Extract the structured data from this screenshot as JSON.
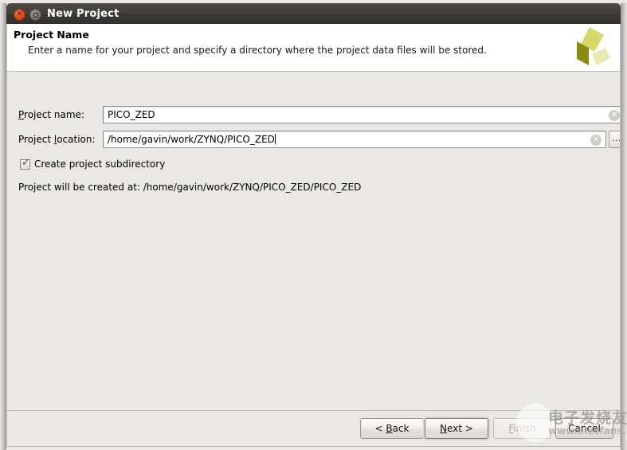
{
  "window": {
    "title": "New Project",
    "close_icon": "close-icon",
    "maximize_icon": "maximize-icon"
  },
  "header": {
    "title": "Project Name",
    "subtitle": "Enter a name for your project and specify a directory where the project data files will be stored.",
    "logo_name": "xilinx-vivado-logo"
  },
  "form": {
    "project_name": {
      "label_pre": "P",
      "label_mnemonic": "",
      "label": "Project name:",
      "value": "PICO_ZED",
      "clear_icon": "clear-icon"
    },
    "project_location": {
      "label": "Project location:",
      "value": "/home/gavin/work/ZYNQ/PICO_ZED",
      "clear_icon": "clear-icon",
      "browse_label": "..."
    },
    "create_subdirectory": {
      "label": "Create project subdirectory",
      "checked": true,
      "check_glyph": "✓"
    },
    "created_at": "Project will be created at: /home/gavin/work/ZYNQ/PICO_ZED/PICO_ZED"
  },
  "footer": {
    "back": "< Back",
    "next": "Next >",
    "finish": "Finish",
    "cancel": "Cancel"
  },
  "watermark": {
    "cn_text": "电子发烧友",
    "url_text": "www.elecfans.com"
  },
  "colors": {
    "titlebar": "#3b3936",
    "dialog_bg": "#eae8e5",
    "header_bg": "#ffffff",
    "close_button": "#d9481c",
    "logo_light": "#d6d86a",
    "logo_mid": "#e3e59a",
    "logo_dark": "#8a8a14"
  }
}
